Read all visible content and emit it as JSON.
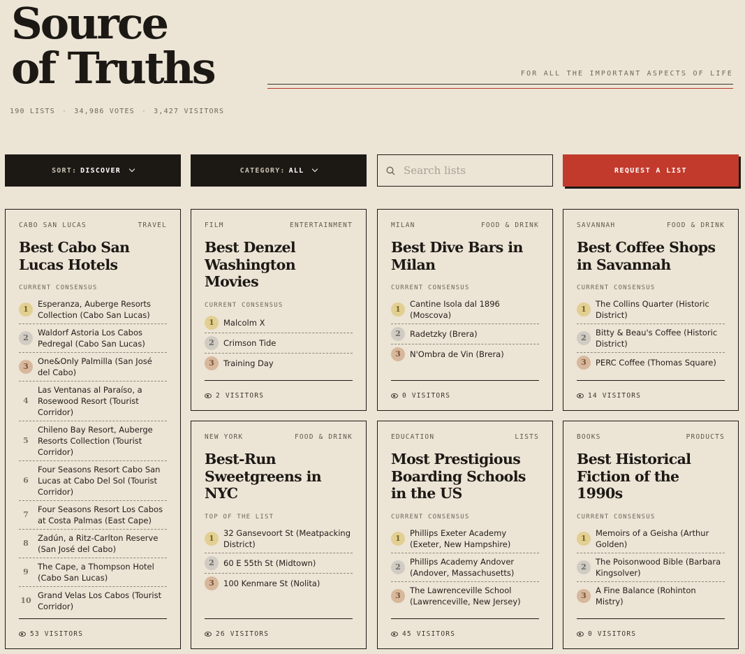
{
  "header": {
    "brand_line1": "Source",
    "brand_line2": "of Truths",
    "tagline": "FOR ALL THE IMPORTANT ASPECTS OF LIFE",
    "stats": [
      "190 LISTS",
      "34,986 VOTES",
      "3,427 VISITORS"
    ],
    "stats_separator": "·"
  },
  "toolbar": {
    "sort_label": "SORT:",
    "sort_value": "DISCOVER",
    "category_label": "CATEGORY:",
    "category_value": "ALL",
    "search_placeholder": "Search lists",
    "request_label": "REQUEST A LIST"
  },
  "cards": [
    {
      "location": "CABO SAN LUCAS",
      "category": "TRAVEL",
      "title": "Best Cabo San Lucas Hotels",
      "label": "CURRENT CONSENSUS",
      "items": [
        "Esperanza, Auberge Resorts Collection (Cabo San Lucas)",
        "Waldorf Astoria Los Cabos Pedregal (Cabo San Lucas)",
        "One&Only Palmilla (San José del Cabo)",
        "Las Ventanas al Paraíso, a Rosewood Resort (Tourist Corridor)",
        "Chileno Bay Resort, Auberge Resorts Collection (Tourist Corridor)",
        "Four Seasons Resort Cabo San Lucas at Cabo Del Sol (Tourist Corridor)",
        "Four Seasons Resort Los Cabos at Costa Palmas (East Cape)",
        "Zadún, a Ritz-Carlton Reserve (San José del Cabo)",
        "The Cape, a Thompson Hotel (Cabo San Lucas)",
        "Grand Velas Los Cabos (Tourist Corridor)"
      ],
      "visitors": "53 VISITORS"
    },
    {
      "location": "FILM",
      "category": "ENTERTAINMENT",
      "title": "Best Denzel Washington Movies",
      "label": "CURRENT CONSENSUS",
      "items": [
        "Malcolm X",
        "Crimson Tide",
        "Training Day"
      ],
      "visitors": "2 VISITORS"
    },
    {
      "location": "MILAN",
      "category": "FOOD & DRINK",
      "title": "Best Dive Bars in Milan",
      "label": "CURRENT CONSENSUS",
      "items": [
        "Cantine Isola dal 1896 (Moscova)",
        "Radetzky (Brera)",
        "N'Ombra de Vin (Brera)"
      ],
      "visitors": "0 VISITORS"
    },
    {
      "location": "SAVANNAH",
      "category": "FOOD & DRINK",
      "title": "Best Coffee Shops in Savannah",
      "label": "CURRENT CONSENSUS",
      "items": [
        "The Collins Quarter (Historic District)",
        "Bitty & Beau's Coffee (Historic District)",
        "PERC Coffee (Thomas Square)"
      ],
      "visitors": "14 VISITORS"
    },
    {
      "location": "NEW YORK",
      "category": "FOOD & DRINK",
      "title": "Best-Run Sweetgreens in NYC",
      "label": "TOP OF THE LIST",
      "items": [
        "32 Gansevoort St (Meatpacking District)",
        "60 E 55th St (Midtown)",
        "100 Kenmare St (Nolita)"
      ],
      "visitors": "26 VISITORS"
    },
    {
      "location": "EDUCATION",
      "category": "LISTS",
      "title": "Most Prestigious Boarding Schools in the US",
      "label": "CURRENT CONSENSUS",
      "items": [
        "Phillips Exeter Academy (Exeter, New Hampshire)",
        "Phillips Academy Andover (Andover, Massachusetts)",
        "The Lawrenceville School (Lawrenceville, New Jersey)"
      ],
      "visitors": "45 VISITORS"
    },
    {
      "location": "BOOKS",
      "category": "PRODUCTS",
      "title": "Best Historical Fiction of the 1990s",
      "label": "CURRENT CONSENSUS",
      "items": [
        "Memoirs of a Geisha (Arthur Golden)",
        "The Poisonwood Bible (Barbara Kingsolver)",
        "A Fine Balance (Rohinton Mistry)"
      ],
      "visitors": "0 VISITORS"
    }
  ],
  "colors": {
    "background": "#ece4d5",
    "ink": "#1c1915",
    "accent_red": "#c23a2c",
    "rank_gold": "#e2cf92",
    "rank_silver": "#d0ccc4",
    "rank_bronze": "#d7b89c"
  },
  "icons": [
    "search-icon",
    "eye-icon",
    "chevron-down-icon"
  ]
}
